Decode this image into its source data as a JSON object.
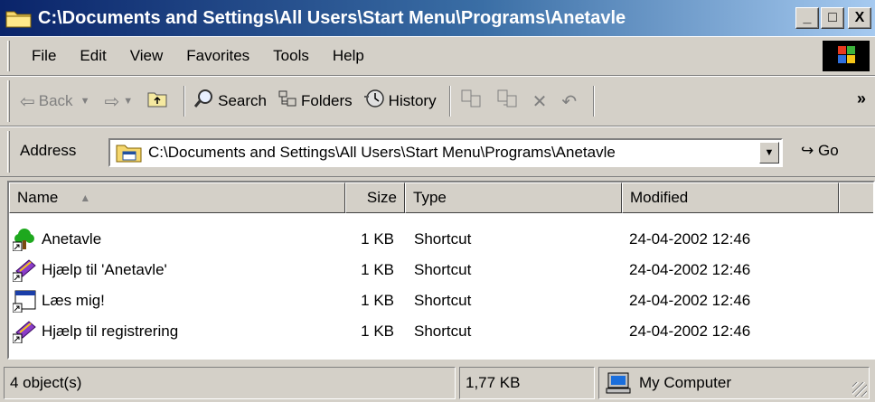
{
  "window": {
    "title": "C:\\Documents and Settings\\All Users\\Start Menu\\Programs\\Anetavle",
    "buttons": {
      "minimize": "_",
      "maximize": "□",
      "close": "X"
    }
  },
  "menu": [
    "File",
    "Edit",
    "View",
    "Favorites",
    "Tools",
    "Help"
  ],
  "toolbar": {
    "back": "Back",
    "search": "Search",
    "folders": "Folders",
    "history": "History",
    "more": "»"
  },
  "address": {
    "label": "Address",
    "value": "C:\\Documents and Settings\\All Users\\Start Menu\\Programs\\Anetavle",
    "go": "Go"
  },
  "columns": {
    "name": "Name",
    "size": "Size",
    "type": "Type",
    "modified": "Modified"
  },
  "files": [
    {
      "name": "Anetavle",
      "size": "1 KB",
      "type": "Shortcut",
      "modified": "24-04-2002 12:46",
      "icon": "tree-icon"
    },
    {
      "name": "Hjælp til 'Anetavle'",
      "size": "1 KB",
      "type": "Shortcut",
      "modified": "24-04-2002 12:46",
      "icon": "help-book-icon"
    },
    {
      "name": "Læs mig!",
      "size": "1 KB",
      "type": "Shortcut",
      "modified": "24-04-2002 12:46",
      "icon": "document-window-icon"
    },
    {
      "name": "Hjælp til registrering",
      "size": "1 KB",
      "type": "Shortcut",
      "modified": "24-04-2002 12:46",
      "icon": "help-book-icon"
    }
  ],
  "status": {
    "objects": "4 object(s)",
    "size": "1,77 KB",
    "zone": "My Computer"
  },
  "colors": {
    "title_start": "#0a246a",
    "title_end": "#a6caf0",
    "chrome": "#d4d0c8"
  }
}
